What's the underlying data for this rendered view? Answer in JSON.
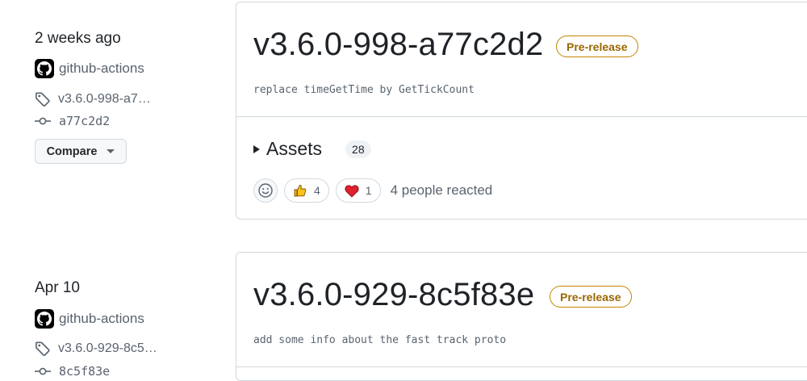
{
  "releases": [
    {
      "date": "2 weeks ago",
      "author": "github-actions",
      "tag": "v3.6.0-998-a7…",
      "commit": "a77c2d2",
      "compare_label": "Compare",
      "title": "v3.6.0-998-a77c2d2",
      "badge": "Pre-release",
      "description": "replace timeGetTime by GetTickCount",
      "assets_label": "Assets",
      "assets_count": "28",
      "reactions": {
        "thumbs_up": "4",
        "heart": "1",
        "summary": "4 people reacted"
      }
    },
    {
      "date": "Apr 10",
      "author": "github-actions",
      "tag": "v3.6.0-929-8c5…",
      "commit": "8c5f83e",
      "title": "v3.6.0-929-8c5f83e",
      "badge": "Pre-release",
      "description": "add some info about the fast track proto"
    }
  ],
  "colors": {
    "badge_border": "#bf8700",
    "badge_text": "#9a6700",
    "border": "#d1d9e0",
    "muted": "#59636e"
  },
  "icons": [
    "github-avatar-icon",
    "tag-icon",
    "commit-icon",
    "chevron-down-icon",
    "smiley-icon",
    "thumbs-up-icon",
    "heart-icon"
  ]
}
